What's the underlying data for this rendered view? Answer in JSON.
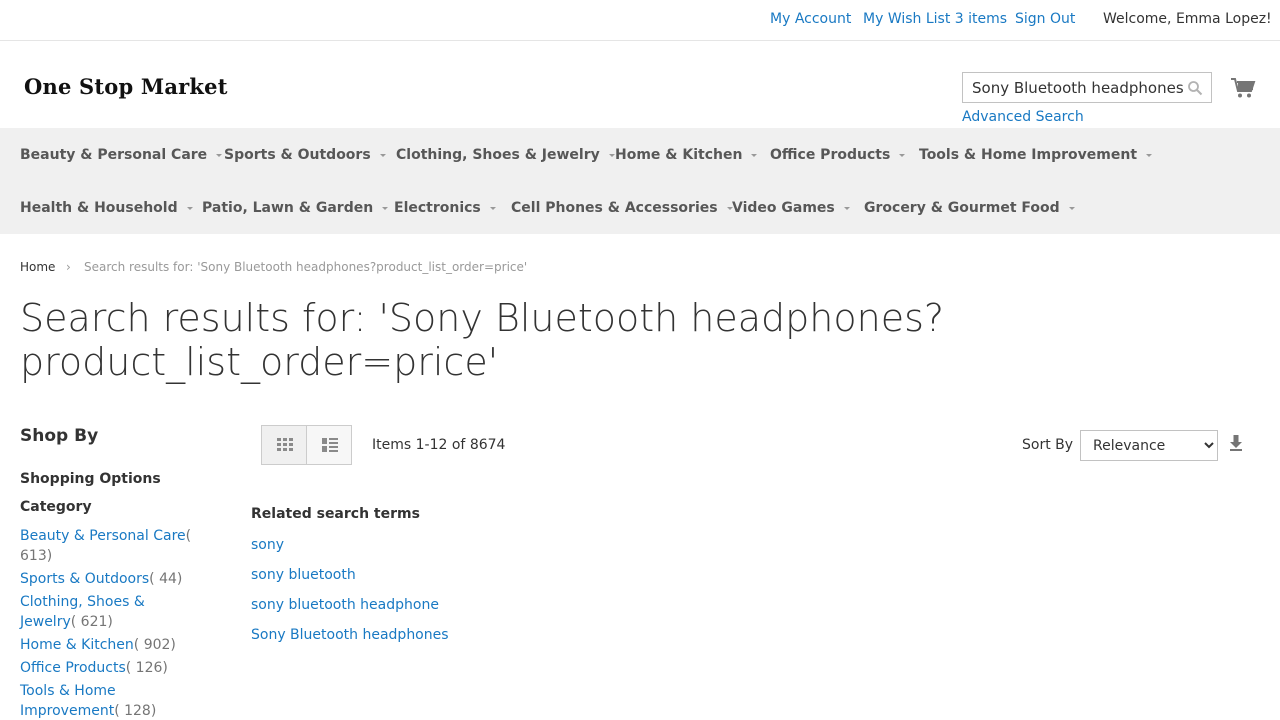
{
  "header": {
    "my_account": "My Account",
    "wish_list": "My Wish List",
    "wish_list_count": "3 items",
    "sign_out": "Sign Out",
    "welcome": "Welcome, Emma Lopez!"
  },
  "logo": {
    "text": "One Stop Market"
  },
  "search": {
    "value": "Sony Bluetooth headphones?product_list_order=price",
    "advanced": "Advanced Search"
  },
  "nav": {
    "row1": [
      "Beauty & Personal Care",
      "Sports & Outdoors",
      "Clothing, Shoes & Jewelry",
      "Home & Kitchen",
      "Office Products",
      "Tools & Home Improvement"
    ],
    "row2": [
      "Health & Household",
      "Patio, Lawn & Garden",
      "Electronics",
      "Cell Phones & Accessories",
      "Video Games",
      "Grocery & Gourmet Food"
    ]
  },
  "breadcrumb": {
    "home": "Home",
    "separator": "›",
    "current": "Search results for: 'Sony Bluetooth headphones?product_list_order=price'"
  },
  "page_title": "Search results for: 'Sony Bluetooth headphones?product_list_order=price'",
  "sidebar": {
    "shop_by": "Shop By",
    "shopping_options": "Shopping Options",
    "category_title": "Category",
    "categories": [
      {
        "name": "Beauty & Personal Care",
        "count": "( 613)"
      },
      {
        "name": "Sports & Outdoors",
        "count": "( 44)"
      },
      {
        "name": "Clothing, Shoes & Jewelry",
        "count": "( 621)"
      },
      {
        "name": "Home & Kitchen",
        "count": "( 902)"
      },
      {
        "name": "Office Products",
        "count": "( 126)"
      },
      {
        "name": "Tools & Home Improvement",
        "count": "( 128)"
      }
    ]
  },
  "toolbar": {
    "items_prefix": "Items",
    "items_range": "1-12",
    "items_of": "of",
    "items_total": "8674",
    "sort_label": "Sort By",
    "sort_selected": "Relevance"
  },
  "related": {
    "title": "Related search terms",
    "terms": [
      "sony",
      "sony bluetooth",
      "sony bluetooth headphone",
      "Sony Bluetooth headphones"
    ]
  },
  "colors": {
    "link": "#1979c3",
    "nav_bg": "#f0f0f0",
    "text": "#333333"
  }
}
